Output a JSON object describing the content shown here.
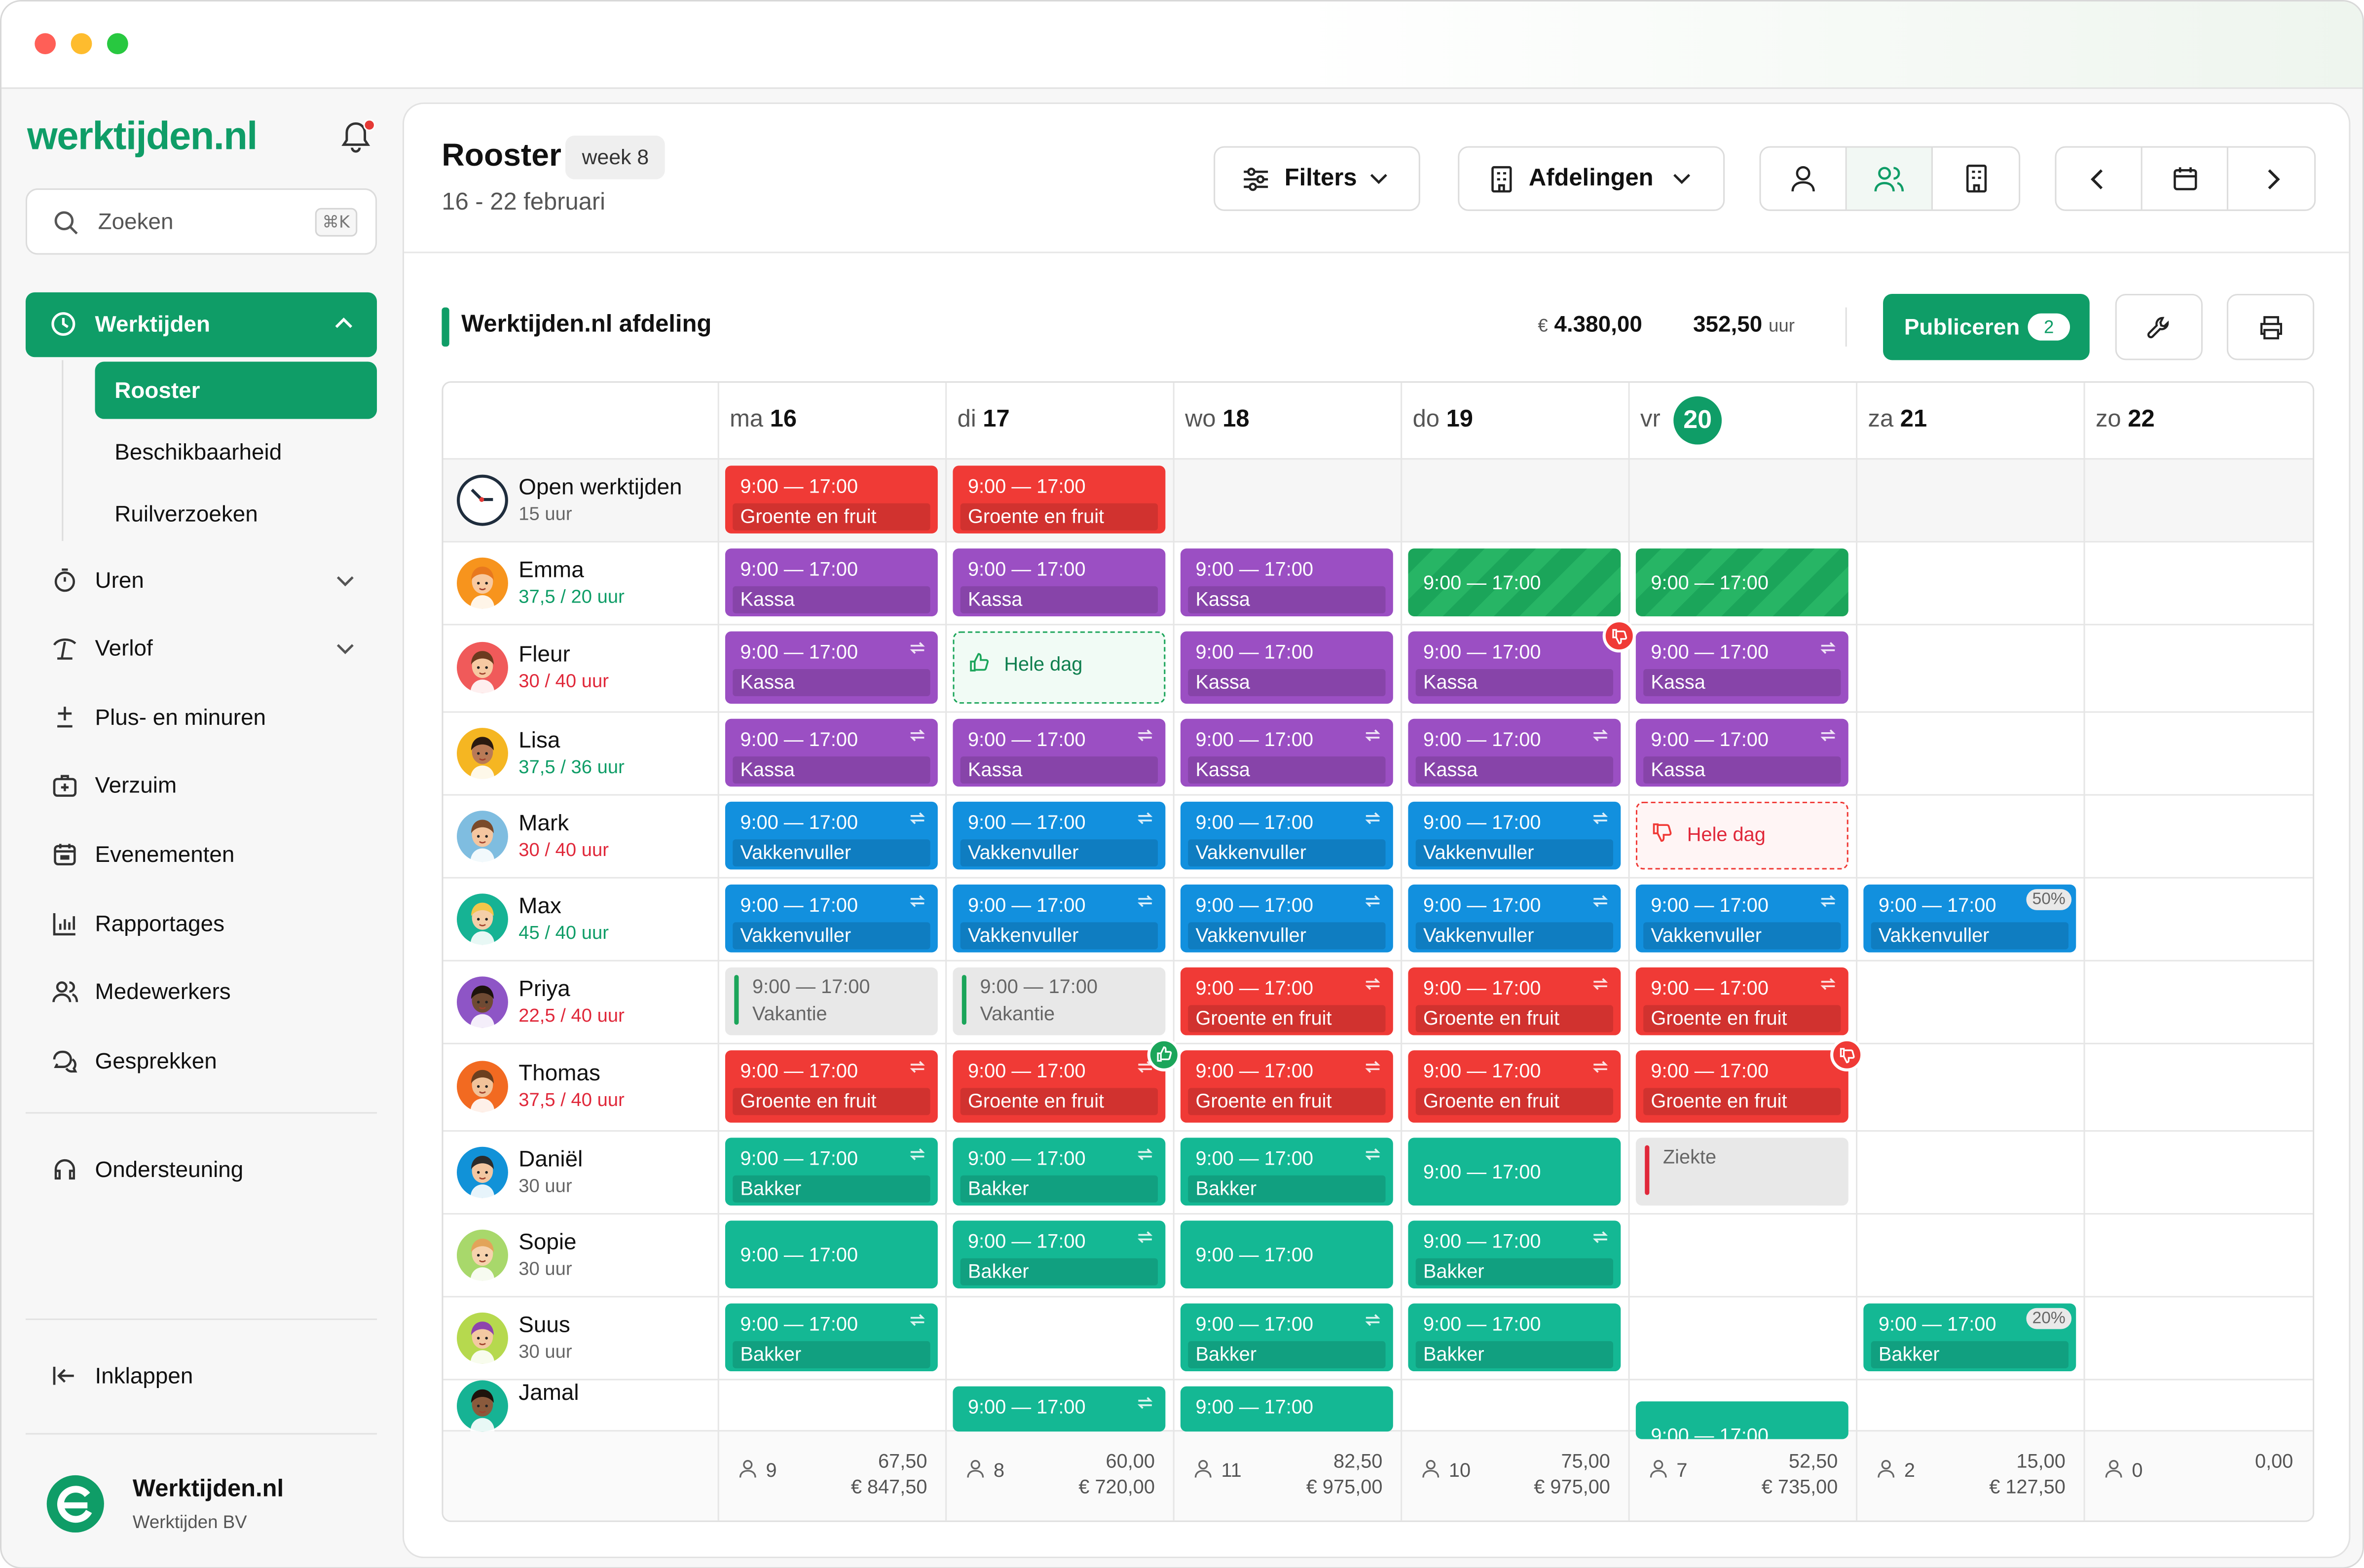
{
  "app": {
    "logo": "werktijden.nl",
    "search_placeholder": "Zoeken",
    "search_shortcut": "⌘K",
    "brand_name": "Werktijden.nl",
    "brand_company": "Werktijden BV"
  },
  "sidebar": {
    "active_section": "Werktijden",
    "sub_items": [
      "Rooster",
      "Beschikbaarheid",
      "Ruilverzoeken"
    ],
    "items": [
      "Uren",
      "Verlof",
      "Plus- en minuren",
      "Verzuim",
      "Evenementen",
      "Rapportages",
      "Medewerkers",
      "Gesprekken"
    ],
    "support": "Ondersteuning",
    "collapse": "Inklappen"
  },
  "header": {
    "title": "Rooster",
    "week": "week 8",
    "date_range": "16 - 22 februari",
    "filters": "Filters",
    "departments": "Afdelingen"
  },
  "department": {
    "name": "Werktijden.nl afdeling",
    "currency": "€",
    "cost": "4.380,00",
    "hours": "352,50",
    "hours_unit": "uur",
    "publish": "Publiceren",
    "publish_count": "2"
  },
  "days": [
    {
      "abbr": "ma",
      "num": "16"
    },
    {
      "abbr": "di",
      "num": "17"
    },
    {
      "abbr": "wo",
      "num": "18"
    },
    {
      "abbr": "do",
      "num": "19"
    },
    {
      "abbr": "vr",
      "num": "20"
    },
    {
      "abbr": "za",
      "num": "21"
    },
    {
      "abbr": "zo",
      "num": "22"
    }
  ],
  "rows": [
    {
      "name": "Open werktijden",
      "hours": "15 uur"
    },
    {
      "name": "Emma",
      "hours": "37,5 / 20 uur"
    },
    {
      "name": "Fleur",
      "hours": "30 / 40 uur"
    },
    {
      "name": "Lisa",
      "hours": "37,5 / 36 uur"
    },
    {
      "name": "Mark",
      "hours": "30 / 40 uur"
    },
    {
      "name": "Max",
      "hours": "45 / 40 uur"
    },
    {
      "name": "Priya",
      "hours": "22,5 / 40 uur"
    },
    {
      "name": "Thomas",
      "hours": "37,5 / 40 uur"
    },
    {
      "name": "Daniël",
      "hours": "30 uur"
    },
    {
      "name": "Sopie",
      "hours": "30 uur"
    },
    {
      "name": "Suus",
      "hours": "30 uur"
    },
    {
      "name": "Jamal",
      "hours": ""
    }
  ],
  "shift_time": "9:00 — 17:00",
  "roles": {
    "groente": "Groente en fruit",
    "kassa": "Kassa",
    "vakkenvuller": "Vakkenvuller",
    "bakker": "Bakker",
    "vakantie": "Vakantie",
    "ziekte": "Ziekte",
    "hele_dag": "Hele dag"
  },
  "percent_badges": [
    "50%",
    "20%"
  ],
  "footer": [
    {
      "count": "9",
      "hours": "67,50",
      "money": "€ 847,50"
    },
    {
      "count": "8",
      "hours": "60,00",
      "money": "€ 720,00"
    },
    {
      "count": "11",
      "hours": "82,50",
      "money": "€ 975,00"
    },
    {
      "count": "10",
      "hours": "75,00",
      "money": "€ 975,00"
    },
    {
      "count": "7",
      "hours": "52,50",
      "money": "€ 735,00"
    },
    {
      "count": "2",
      "hours": "15,00",
      "money": "€ 127,50"
    },
    {
      "count": "0",
      "hours": "0,00",
      "money": ""
    }
  ],
  "colors": {
    "brand": "#0f9d67",
    "groente": "#f03a36",
    "kassa": "#9b4fc3",
    "vakkenvuller": "#1290de",
    "bakker": "#14b894",
    "approved": "#1ba55a"
  }
}
